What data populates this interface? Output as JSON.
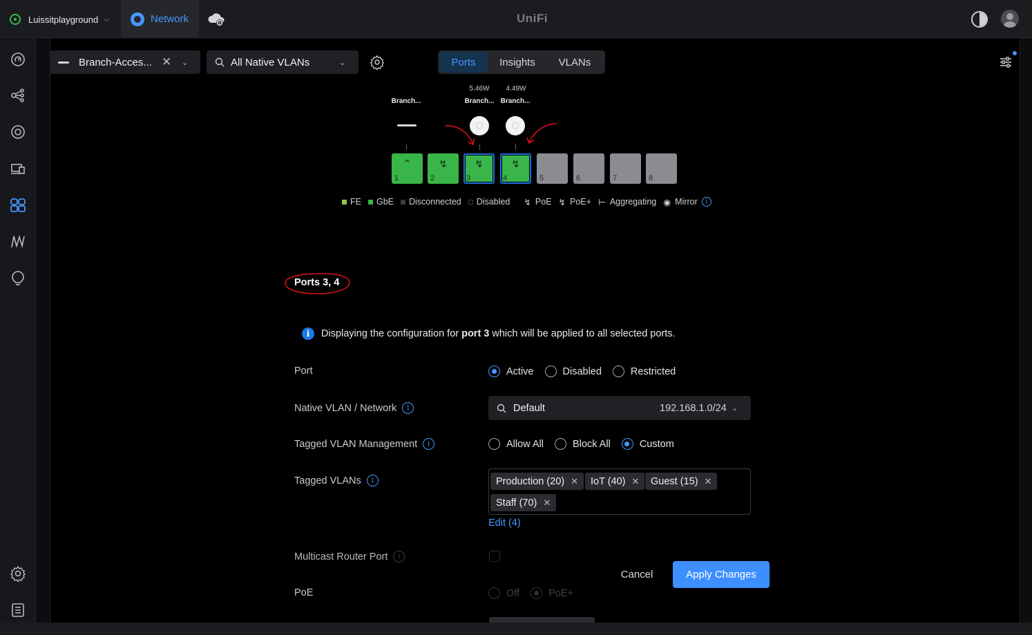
{
  "topbar": {
    "site_name": "Luissitplayground",
    "app_tab": "Network",
    "logo": "UniFi",
    "icons": [
      "site-status-icon",
      "network-app-icon",
      "cloud-gear-icon",
      "theme-toggle-icon",
      "avatar"
    ]
  },
  "toolbar": {
    "device_name": "Branch-Acces...",
    "vlan_filter": "All Native VLANs",
    "tabs": [
      {
        "label": "Ports",
        "active": true
      },
      {
        "label": "Insights",
        "active": false
      },
      {
        "label": "VLANs",
        "active": false
      }
    ]
  },
  "diagram": {
    "connected": [
      {
        "port": 1,
        "label": "Branch...",
        "power": ""
      },
      {
        "port": 3,
        "label": "Branch...",
        "power": "5.46W"
      },
      {
        "port": 4,
        "label": "Branch...",
        "power": "4.49W"
      }
    ],
    "ports": [
      {
        "num": "1",
        "state": "uplink",
        "selected": false
      },
      {
        "num": "2",
        "state": "poe+",
        "selected": false
      },
      {
        "num": "3",
        "state": "poe+",
        "selected": true
      },
      {
        "num": "4",
        "state": "poe+",
        "selected": true
      },
      {
        "num": "5",
        "state": "disconnected",
        "selected": false
      },
      {
        "num": "6",
        "state": "disconnected",
        "selected": false
      },
      {
        "num": "7",
        "state": "disconnected",
        "selected": false
      },
      {
        "num": "8",
        "state": "disconnected",
        "selected": false
      }
    ],
    "legend": {
      "fe": "FE",
      "gbe": "GbE",
      "disconnected": "Disconnected",
      "disabled": "Disabled",
      "poe": "PoE",
      "poe_plus": "PoE+",
      "aggregating": "Aggregating",
      "mirror": "Mirror"
    },
    "colors": {
      "fe": "#9bc53d",
      "gbe": "#39b54a",
      "disconnected": "#3a3c40",
      "accent": "#4797ff",
      "annotation": "#d9121f"
    }
  },
  "config": {
    "title": "Ports 3, 4",
    "info": {
      "prefix": "Displaying the configuration for ",
      "bold": "port 3",
      "suffix": " which will be applied to all selected ports."
    },
    "port": {
      "label": "Port",
      "options": [
        "Active",
        "Disabled",
        "Restricted"
      ],
      "selected": "Active"
    },
    "native_vlan": {
      "label": "Native VLAN / Network",
      "value": "Default",
      "subnet": "192.168.1.0/24"
    },
    "tagged_mgmt": {
      "label": "Tagged VLAN Management",
      "options": [
        "Allow All",
        "Block All",
        "Custom"
      ],
      "selected": "Custom"
    },
    "tagged_vlans": {
      "label": "Tagged VLANs",
      "chips": [
        "Production (20)",
        "IoT (40)",
        "Guest (15)",
        "Staff (70)"
      ],
      "edit": "Edit (4)"
    },
    "multicast": {
      "label": "Multicast Router Port",
      "checked": false
    },
    "poe": {
      "label": "PoE",
      "options": [
        "Off",
        "PoE+"
      ],
      "selected": "PoE+"
    }
  },
  "actions": {
    "cancel": "Cancel",
    "apply": "Apply Changes"
  }
}
